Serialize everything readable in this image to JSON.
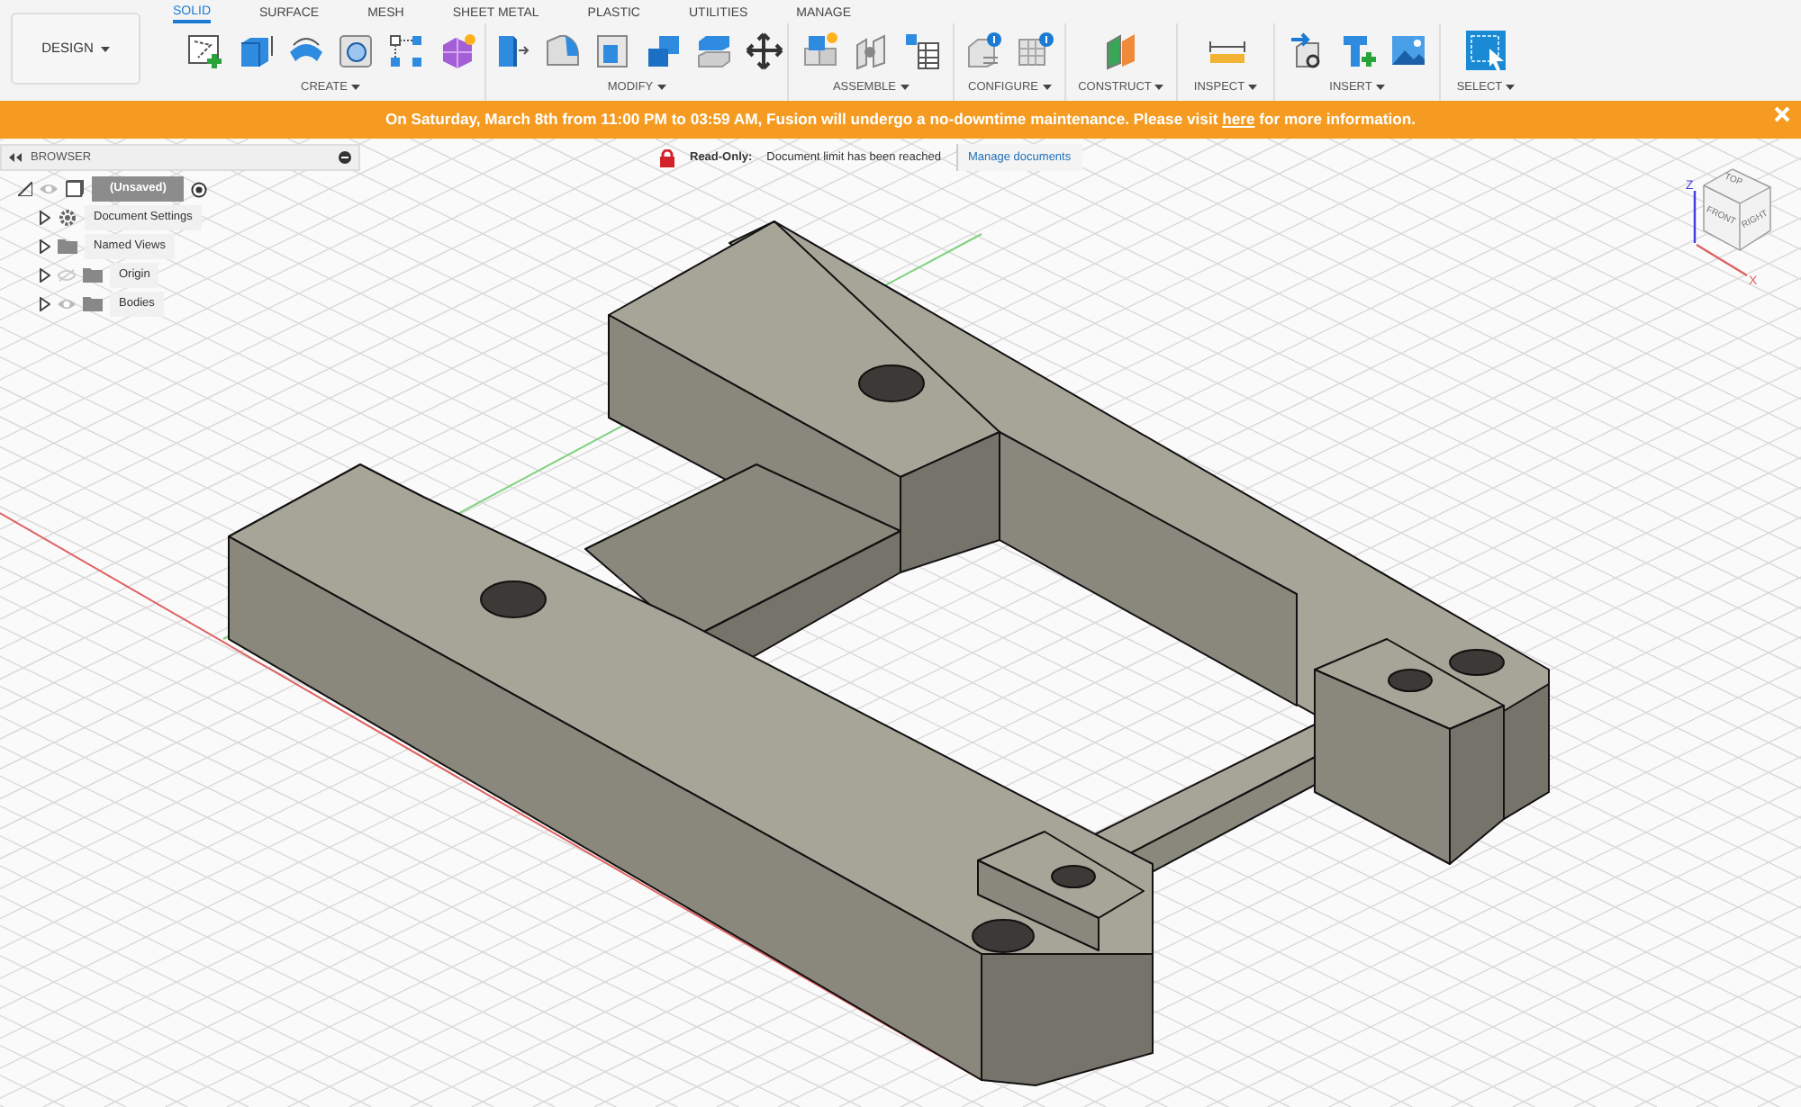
{
  "workspace": {
    "label": "DESIGN"
  },
  "tabs": [
    {
      "label": "SOLID",
      "selected": true
    },
    {
      "label": "SURFACE",
      "selected": false
    },
    {
      "label": "MESH",
      "selected": false
    },
    {
      "label": "SHEET METAL",
      "selected": false
    },
    {
      "label": "PLASTIC",
      "selected": false
    },
    {
      "label": "UTILITIES",
      "selected": false
    },
    {
      "label": "MANAGE",
      "selected": false
    }
  ],
  "groups": [
    {
      "label": "CREATE"
    },
    {
      "label": "MODIFY"
    },
    {
      "label": "ASSEMBLE"
    },
    {
      "label": "CONFIGURE"
    },
    {
      "label": "CONSTRUCT"
    },
    {
      "label": "INSPECT"
    },
    {
      "label": "INSERT"
    },
    {
      "label": "SELECT"
    }
  ],
  "banner": {
    "before": "On Saturday, March 8th from 11:00 PM to 03:59 AM, Fusion will undergo a no-downtime maintenance. Please visit ",
    "link": "here",
    "after": " for more information."
  },
  "browser": {
    "title": "BROWSER",
    "tree": [
      {
        "label": "(Unsaved)",
        "kind": "component",
        "expanded": true,
        "visible": true,
        "children": [
          {
            "label": "Document Settings",
            "kind": "settings",
            "expanded": false
          },
          {
            "label": "Named Views",
            "kind": "folder",
            "expanded": false
          },
          {
            "label": "Origin",
            "kind": "folder",
            "expanded": false,
            "visible": false
          },
          {
            "label": "Bodies",
            "kind": "folder",
            "expanded": false,
            "visible": true
          }
        ]
      }
    ]
  },
  "read_only": {
    "label": "Read-Only:",
    "message": "Document limit has been reached",
    "link": "Manage documents"
  },
  "view_cube": {
    "faces": [
      "TOP",
      "FRONT",
      "RIGHT"
    ],
    "axes": [
      "Z",
      "X"
    ]
  }
}
